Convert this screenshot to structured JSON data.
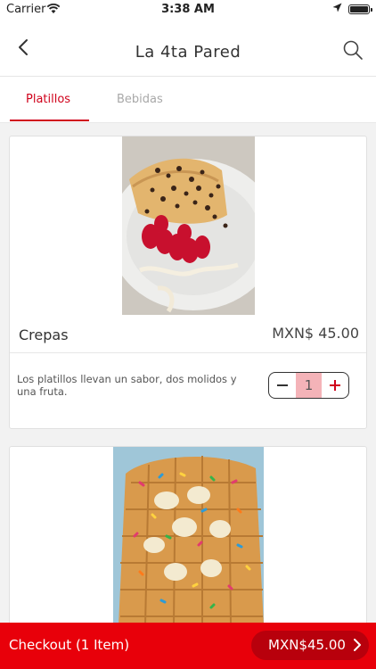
{
  "status_bar": {
    "carrier": "Carrier",
    "time": "3:38 AM"
  },
  "nav": {
    "title": "La 4ta Pared"
  },
  "tabs": [
    {
      "label": "Platillos",
      "active": true
    },
    {
      "label": "Bebidas",
      "active": false
    }
  ],
  "items": [
    {
      "name": "Crepas",
      "price": "MXN$ 45.00",
      "description": "Los platillos llevan un sabor, dos molidos y una fruta.",
      "quantity": "1"
    }
  ],
  "checkout": {
    "label": "Checkout (1 Item)",
    "total": "MXN$45.00"
  },
  "colors": {
    "accent": "#d0021b",
    "checkout_bar": "#e8000a",
    "checkout_total_bg": "#b8000c",
    "quantity_bg": "#f4b3b8"
  },
  "icons": [
    "wifi-icon",
    "location-icon",
    "battery-icon",
    "back-arrow-icon",
    "search-icon",
    "minus-icon",
    "plus-icon",
    "chevron-right-icon"
  ]
}
